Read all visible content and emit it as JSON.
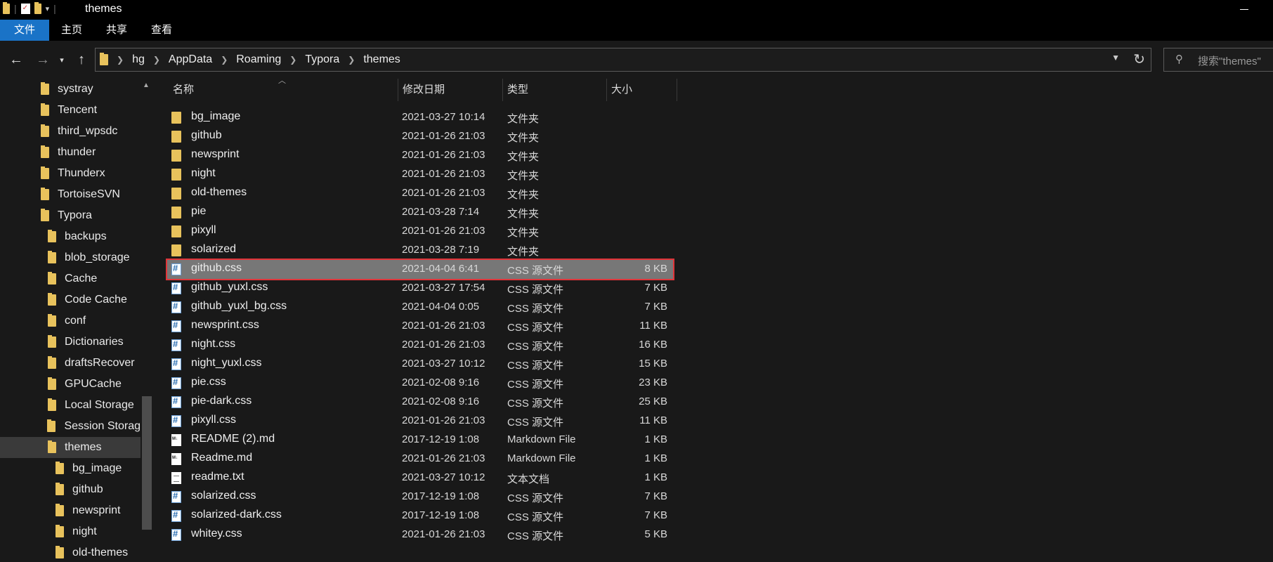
{
  "window": {
    "title": "themes"
  },
  "ribbon": {
    "tabs": [
      {
        "label": "文件",
        "active": true
      },
      {
        "label": "主页"
      },
      {
        "label": "共享"
      },
      {
        "label": "查看"
      }
    ]
  },
  "addressbar": {
    "crumbs": [
      "hg",
      "AppData",
      "Roaming",
      "Typora",
      "themes"
    ]
  },
  "search": {
    "placeholder": "搜索\"themes\""
  },
  "nav": {
    "items": [
      {
        "label": "systray",
        "indent": 0
      },
      {
        "label": "Tencent",
        "indent": 0
      },
      {
        "label": "third_wpsdc",
        "indent": 0
      },
      {
        "label": "thunder",
        "indent": 0
      },
      {
        "label": "Thunderx",
        "indent": 0
      },
      {
        "label": "TortoiseSVN",
        "indent": 0
      },
      {
        "label": "Typora",
        "indent": 0
      },
      {
        "label": "backups",
        "indent": 1
      },
      {
        "label": "blob_storage",
        "indent": 1
      },
      {
        "label": "Cache",
        "indent": 1
      },
      {
        "label": "Code Cache",
        "indent": 1
      },
      {
        "label": "conf",
        "indent": 1
      },
      {
        "label": "Dictionaries",
        "indent": 1
      },
      {
        "label": "draftsRecover",
        "indent": 1
      },
      {
        "label": "GPUCache",
        "indent": 1
      },
      {
        "label": "Local Storage",
        "indent": 1
      },
      {
        "label": "Session Storag",
        "indent": 1
      },
      {
        "label": "themes",
        "indent": 1,
        "selected": true
      },
      {
        "label": "bg_image",
        "indent": 2
      },
      {
        "label": "github",
        "indent": 2
      },
      {
        "label": "newsprint",
        "indent": 2
      },
      {
        "label": "night",
        "indent": 2
      },
      {
        "label": "old-themes",
        "indent": 2
      }
    ]
  },
  "columns": {
    "name": "名称",
    "date": "修改日期",
    "type": "类型",
    "size": "大小"
  },
  "files": [
    {
      "name": "bg_image",
      "date": "2021-03-27 10:14",
      "type": "文件夹",
      "size": "",
      "icon": "folder-icon"
    },
    {
      "name": "github",
      "date": "2021-01-26 21:03",
      "type": "文件夹",
      "size": "",
      "icon": "folder-icon"
    },
    {
      "name": "newsprint",
      "date": "2021-01-26 21:03",
      "type": "文件夹",
      "size": "",
      "icon": "folder-icon"
    },
    {
      "name": "night",
      "date": "2021-01-26 21:03",
      "type": "文件夹",
      "size": "",
      "icon": "folder-icon"
    },
    {
      "name": "old-themes",
      "date": "2021-01-26 21:03",
      "type": "文件夹",
      "size": "",
      "icon": "folder-icon"
    },
    {
      "name": "pie",
      "date": "2021-03-28 7:14",
      "type": "文件夹",
      "size": "",
      "icon": "folder-icon"
    },
    {
      "name": "pixyll",
      "date": "2021-01-26 21:03",
      "type": "文件夹",
      "size": "",
      "icon": "folder-icon"
    },
    {
      "name": "solarized",
      "date": "2021-03-28 7:19",
      "type": "文件夹",
      "size": "",
      "icon": "folder-icon"
    },
    {
      "name": "github.css",
      "date": "2021-04-04 6:41",
      "type": "CSS 源文件",
      "size": "8 KB",
      "icon": "css-file-icon",
      "selected": true
    },
    {
      "name": "github_yuxl.css",
      "date": "2021-03-27 17:54",
      "type": "CSS 源文件",
      "size": "7 KB",
      "icon": "css-file-icon"
    },
    {
      "name": "github_yuxl_bg.css",
      "date": "2021-04-04 0:05",
      "type": "CSS 源文件",
      "size": "7 KB",
      "icon": "css-file-icon"
    },
    {
      "name": "newsprint.css",
      "date": "2021-01-26 21:03",
      "type": "CSS 源文件",
      "size": "11 KB",
      "icon": "css-file-icon"
    },
    {
      "name": "night.css",
      "date": "2021-01-26 21:03",
      "type": "CSS 源文件",
      "size": "16 KB",
      "icon": "css-file-icon"
    },
    {
      "name": "night_yuxl.css",
      "date": "2021-03-27 10:12",
      "type": "CSS 源文件",
      "size": "15 KB",
      "icon": "css-file-icon"
    },
    {
      "name": "pie.css",
      "date": "2021-02-08 9:16",
      "type": "CSS 源文件",
      "size": "23 KB",
      "icon": "css-file-icon"
    },
    {
      "name": "pie-dark.css",
      "date": "2021-02-08 9:16",
      "type": "CSS 源文件",
      "size": "25 KB",
      "icon": "css-file-icon"
    },
    {
      "name": "pixyll.css",
      "date": "2021-01-26 21:03",
      "type": "CSS 源文件",
      "size": "11 KB",
      "icon": "css-file-icon"
    },
    {
      "name": "README (2).md",
      "date": "2017-12-19 1:08",
      "type": "Markdown File",
      "size": "1 KB",
      "icon": "markdown-file-icon"
    },
    {
      "name": "Readme.md",
      "date": "2021-01-26 21:03",
      "type": "Markdown File",
      "size": "1 KB",
      "icon": "markdown-file-icon"
    },
    {
      "name": "readme.txt",
      "date": "2021-03-27 10:12",
      "type": "文本文档",
      "size": "1 KB",
      "icon": "text-file-icon"
    },
    {
      "name": "solarized.css",
      "date": "2017-12-19 1:08",
      "type": "CSS 源文件",
      "size": "7 KB",
      "icon": "css-file-icon"
    },
    {
      "name": "solarized-dark.css",
      "date": "2017-12-19 1:08",
      "type": "CSS 源文件",
      "size": "7 KB",
      "icon": "css-file-icon"
    },
    {
      "name": "whitey.css",
      "date": "2021-01-26 21:03",
      "type": "CSS 源文件",
      "size": "5 KB",
      "icon": "css-file-icon"
    }
  ],
  "colors": {
    "accent": "#1a73c7",
    "selection_outline": "#e0353a",
    "folder": "#e8c25c"
  }
}
